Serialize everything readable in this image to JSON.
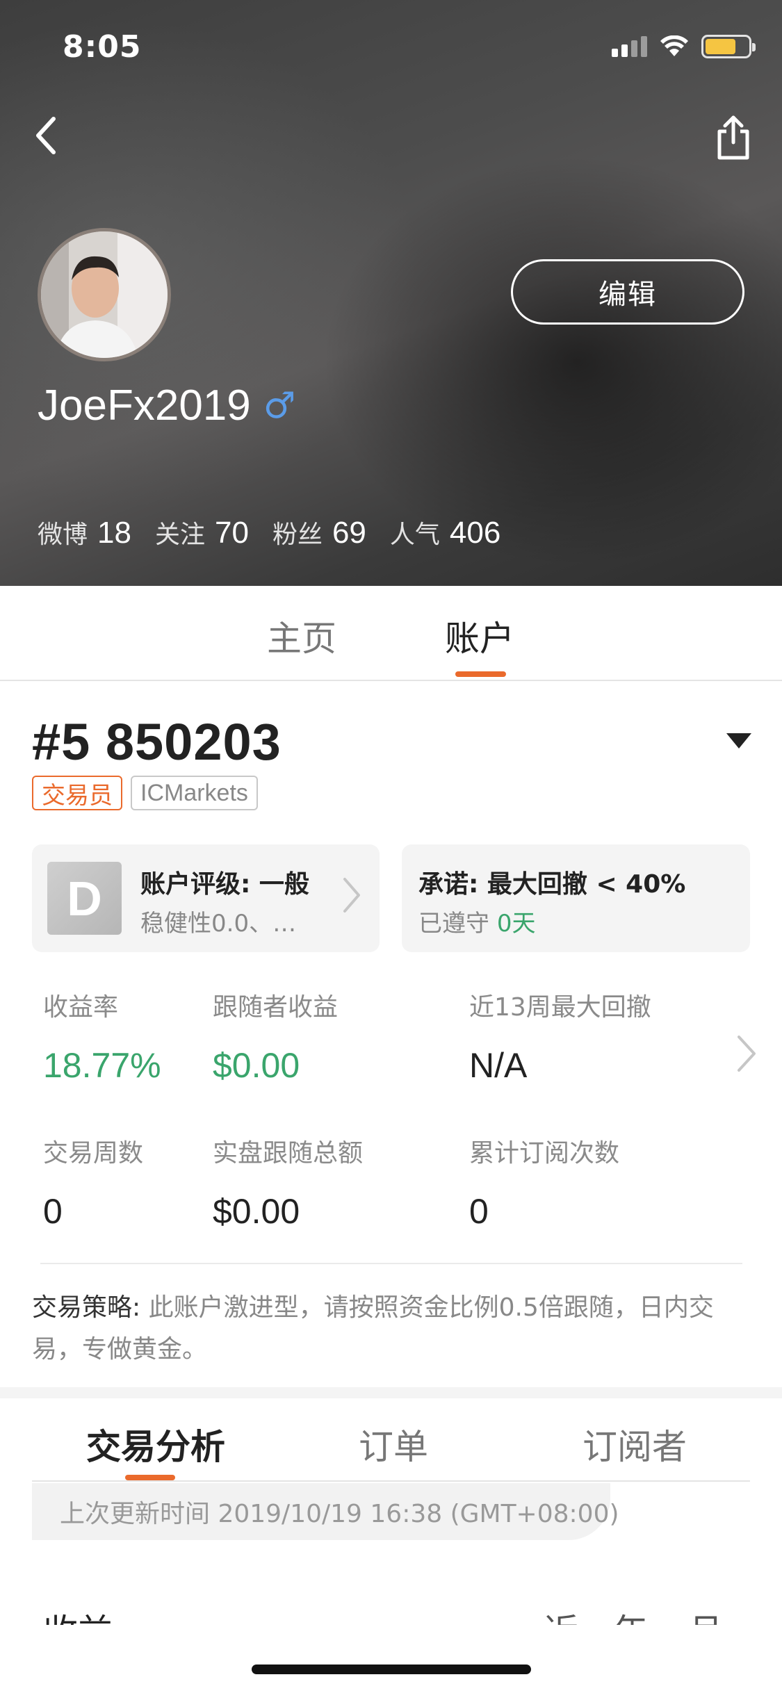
{
  "status_bar": {
    "time": "8:05",
    "battery_color": "#f5c542"
  },
  "header": {
    "back_icon": "chevron-left-icon",
    "share_icon": "share-icon",
    "edit_label": "编辑",
    "username": "JoeFx2019",
    "gender_symbol": "♂",
    "stats": [
      {
        "label": "微博",
        "value": "18"
      },
      {
        "label": "关注",
        "value": "70"
      },
      {
        "label": "粉丝",
        "value": "69"
      },
      {
        "label": "人气",
        "value": "406"
      }
    ]
  },
  "main_tabs": [
    {
      "label": "主页",
      "active": false
    },
    {
      "label": "账户",
      "active": true
    }
  ],
  "account": {
    "number": "#5 850203",
    "tags": {
      "trader": "交易员",
      "broker": "ICMarkets"
    },
    "rating_card": {
      "grade": "D",
      "title": "账户评级: 一般",
      "subtitle": "稳健性0.0、…"
    },
    "promise_card": {
      "title": "承诺: 最大回撤 < 40%",
      "kept_label": "已遵守",
      "kept_value": "0天"
    },
    "metrics": [
      {
        "label": "收益率",
        "value": "18.77%",
        "highlight": true
      },
      {
        "label": "跟随者收益",
        "value": "$0.00",
        "highlight": true
      },
      {
        "label": "近13周最大回撤",
        "value": "N/A",
        "highlight": false
      },
      {
        "label": "交易周数",
        "value": "0",
        "highlight": false
      },
      {
        "label": "实盘跟随总额",
        "value": "$0.00",
        "highlight": false
      },
      {
        "label": "累计订阅次数",
        "value": "0",
        "highlight": false
      }
    ],
    "strategy": {
      "label": "交易策略:",
      "text": "此账户激进型，请按照资金比例0.5倍跟随，日内交易，专做黄金。"
    }
  },
  "sub_tabs": [
    {
      "label": "交易分析",
      "active": true
    },
    {
      "label": "订单",
      "active": false
    },
    {
      "label": "订阅者",
      "active": false
    }
  ],
  "update_text": "上次更新时间 2019/10/19 16:38 (GMT+08:00)",
  "partial_row": {
    "left": "收益",
    "mid": "近一年",
    "right": "月"
  },
  "colors": {
    "accent": "#ea6a2c",
    "positive": "#3aa56c",
    "gender": "#5b9ce8"
  }
}
